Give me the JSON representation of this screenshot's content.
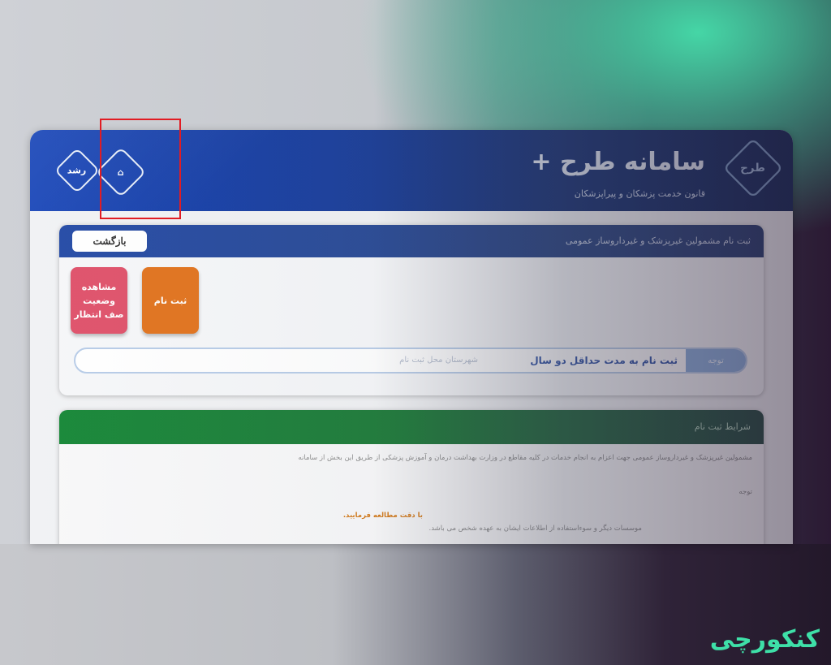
{
  "header": {
    "title": "سامانه طرح +",
    "subtitle": "قانون خدمت پزشکان و پیراپزشکان",
    "logo_text": "طرح",
    "badge_rushd_text": "رشد",
    "badge_home_text": "⌂"
  },
  "panel": {
    "title": "ثبت نام مشمولین غیرپزشک و غیرداروساز عمومی",
    "back_label": "بازگشت",
    "tiles": [
      {
        "label": "مشاهده وضعیت صف انتظار",
        "color": "#e0556e"
      },
      {
        "label": "ثبت نام",
        "color": "#e27622"
      }
    ],
    "notice_text": "ثبت نام به مدت حداقل دو سال",
    "notice_faded": "شهرستان محل ثبت نام",
    "notice_button": "توجه"
  },
  "terms": {
    "title": "شرایط ثبت نام",
    "lines": [
      "مشمولین غیرپزشک و غیرداروساز عمومی جهت اعزام به انجام خدمات در کلیه مقاطع در وزارت بهداشت درمان و آموزش پزشکی از طریق این بخش از سامانه",
      "توجه",
      "با دقت مطالعه فرمایید.",
      "موسسات دیگر و سوءاستفاده از اطلاعات ایشان به عهده شخص می باشد."
    ]
  },
  "brand": {
    "name": "کنکورچی"
  },
  "colors": {
    "header_blue": "#1b3f9c",
    "accent_green": "#3ee0a8",
    "highlight_red": "#e11c23"
  }
}
